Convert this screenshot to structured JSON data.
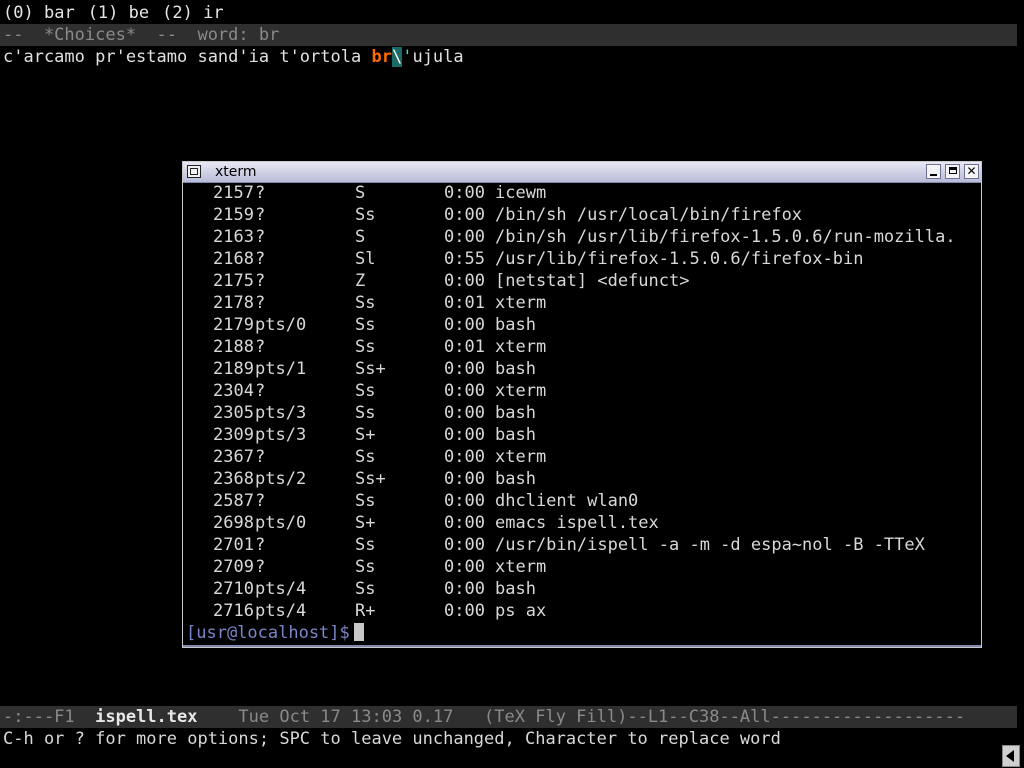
{
  "emacs": {
    "choices": [
      {
        "index": "(0)",
        "word": "bar"
      },
      {
        "index": "(1)",
        "word": "be"
      },
      {
        "index": "(2)",
        "word": "ir"
      }
    ],
    "choices_modeline": "--  *Choices*  --  word: br",
    "word_line": {
      "before": "c'arcamo pr'estamo sand'ia t'ortola ",
      "highlight": "br",
      "backslash": "\\",
      "quote": "'",
      "after": "ujula"
    },
    "bottom_modeline": {
      "prefix": "-:---F1  ",
      "buffer_name": "ispell.tex",
      "suffix": "    Tue Oct 17 13:03 0.17   (TeX Fly Fill)--L1--C38--All-------------------"
    },
    "echo_area": "C-h or ? for more options; SPC to leave unchanged, Character to replace word"
  },
  "xterm": {
    "title": "xterm",
    "processes": [
      {
        "pid": "2157",
        "tty": "?",
        "stat": "S",
        "time": "0:00",
        "command": "icewm"
      },
      {
        "pid": "2159",
        "tty": "?",
        "stat": "Ss",
        "time": "0:00",
        "command": "/bin/sh /usr/local/bin/firefox"
      },
      {
        "pid": "2163",
        "tty": "?",
        "stat": "S",
        "time": "0:00",
        "command": "/bin/sh /usr/lib/firefox-1.5.0.6/run-mozilla."
      },
      {
        "pid": "2168",
        "tty": "?",
        "stat": "Sl",
        "time": "0:55",
        "command": "/usr/lib/firefox-1.5.0.6/firefox-bin"
      },
      {
        "pid": "2175",
        "tty": "?",
        "stat": "Z",
        "time": "0:00",
        "command": "[netstat] <defunct>"
      },
      {
        "pid": "2178",
        "tty": "?",
        "stat": "Ss",
        "time": "0:01",
        "command": "xterm"
      },
      {
        "pid": "2179",
        "tty": "pts/0",
        "stat": "Ss",
        "time": "0:00",
        "command": "bash"
      },
      {
        "pid": "2188",
        "tty": "?",
        "stat": "Ss",
        "time": "0:01",
        "command": "xterm"
      },
      {
        "pid": "2189",
        "tty": "pts/1",
        "stat": "Ss+",
        "time": "0:00",
        "command": "bash"
      },
      {
        "pid": "2304",
        "tty": "?",
        "stat": "Ss",
        "time": "0:00",
        "command": "xterm"
      },
      {
        "pid": "2305",
        "tty": "pts/3",
        "stat": "Ss",
        "time": "0:00",
        "command": "bash"
      },
      {
        "pid": "2309",
        "tty": "pts/3",
        "stat": "S+",
        "time": "0:00",
        "command": "bash"
      },
      {
        "pid": "2367",
        "tty": "?",
        "stat": "Ss",
        "time": "0:00",
        "command": "xterm"
      },
      {
        "pid": "2368",
        "tty": "pts/2",
        "stat": "Ss+",
        "time": "0:00",
        "command": "bash"
      },
      {
        "pid": "2587",
        "tty": "?",
        "stat": "Ss",
        "time": "0:00",
        "command": "dhclient wlan0"
      },
      {
        "pid": "2698",
        "tty": "pts/0",
        "stat": "S+",
        "time": "0:00",
        "command": "emacs ispell.tex"
      },
      {
        "pid": "2701",
        "tty": "?",
        "stat": "Ss",
        "time": "0:00",
        "command": "/usr/bin/ispell -a -m -d espa~nol -B -TTeX"
      },
      {
        "pid": "2709",
        "tty": "?",
        "stat": "Ss",
        "time": "0:00",
        "command": "xterm"
      },
      {
        "pid": "2710",
        "tty": "pts/4",
        "stat": "Ss",
        "time": "0:00",
        "command": "bash"
      },
      {
        "pid": "2716",
        "tty": "pts/4",
        "stat": "R+",
        "time": "0:00",
        "command": "ps ax"
      }
    ],
    "prompt": "[usr@localhost]$"
  },
  "colors": {
    "background": "#000000",
    "modeline_bg": "#2f2f2f",
    "highlight_word": "#ff6a00",
    "highlight_quote": "#2fe0d0",
    "prompt": "#7a86c8",
    "titlebar": "#b8bcd8"
  },
  "icons": {
    "window_menu": "window-menu-icon",
    "minimize": "minimize-icon",
    "maximize": "maximize-icon",
    "close": "close-icon",
    "scroll": "scroll-left-arrow-icon"
  }
}
